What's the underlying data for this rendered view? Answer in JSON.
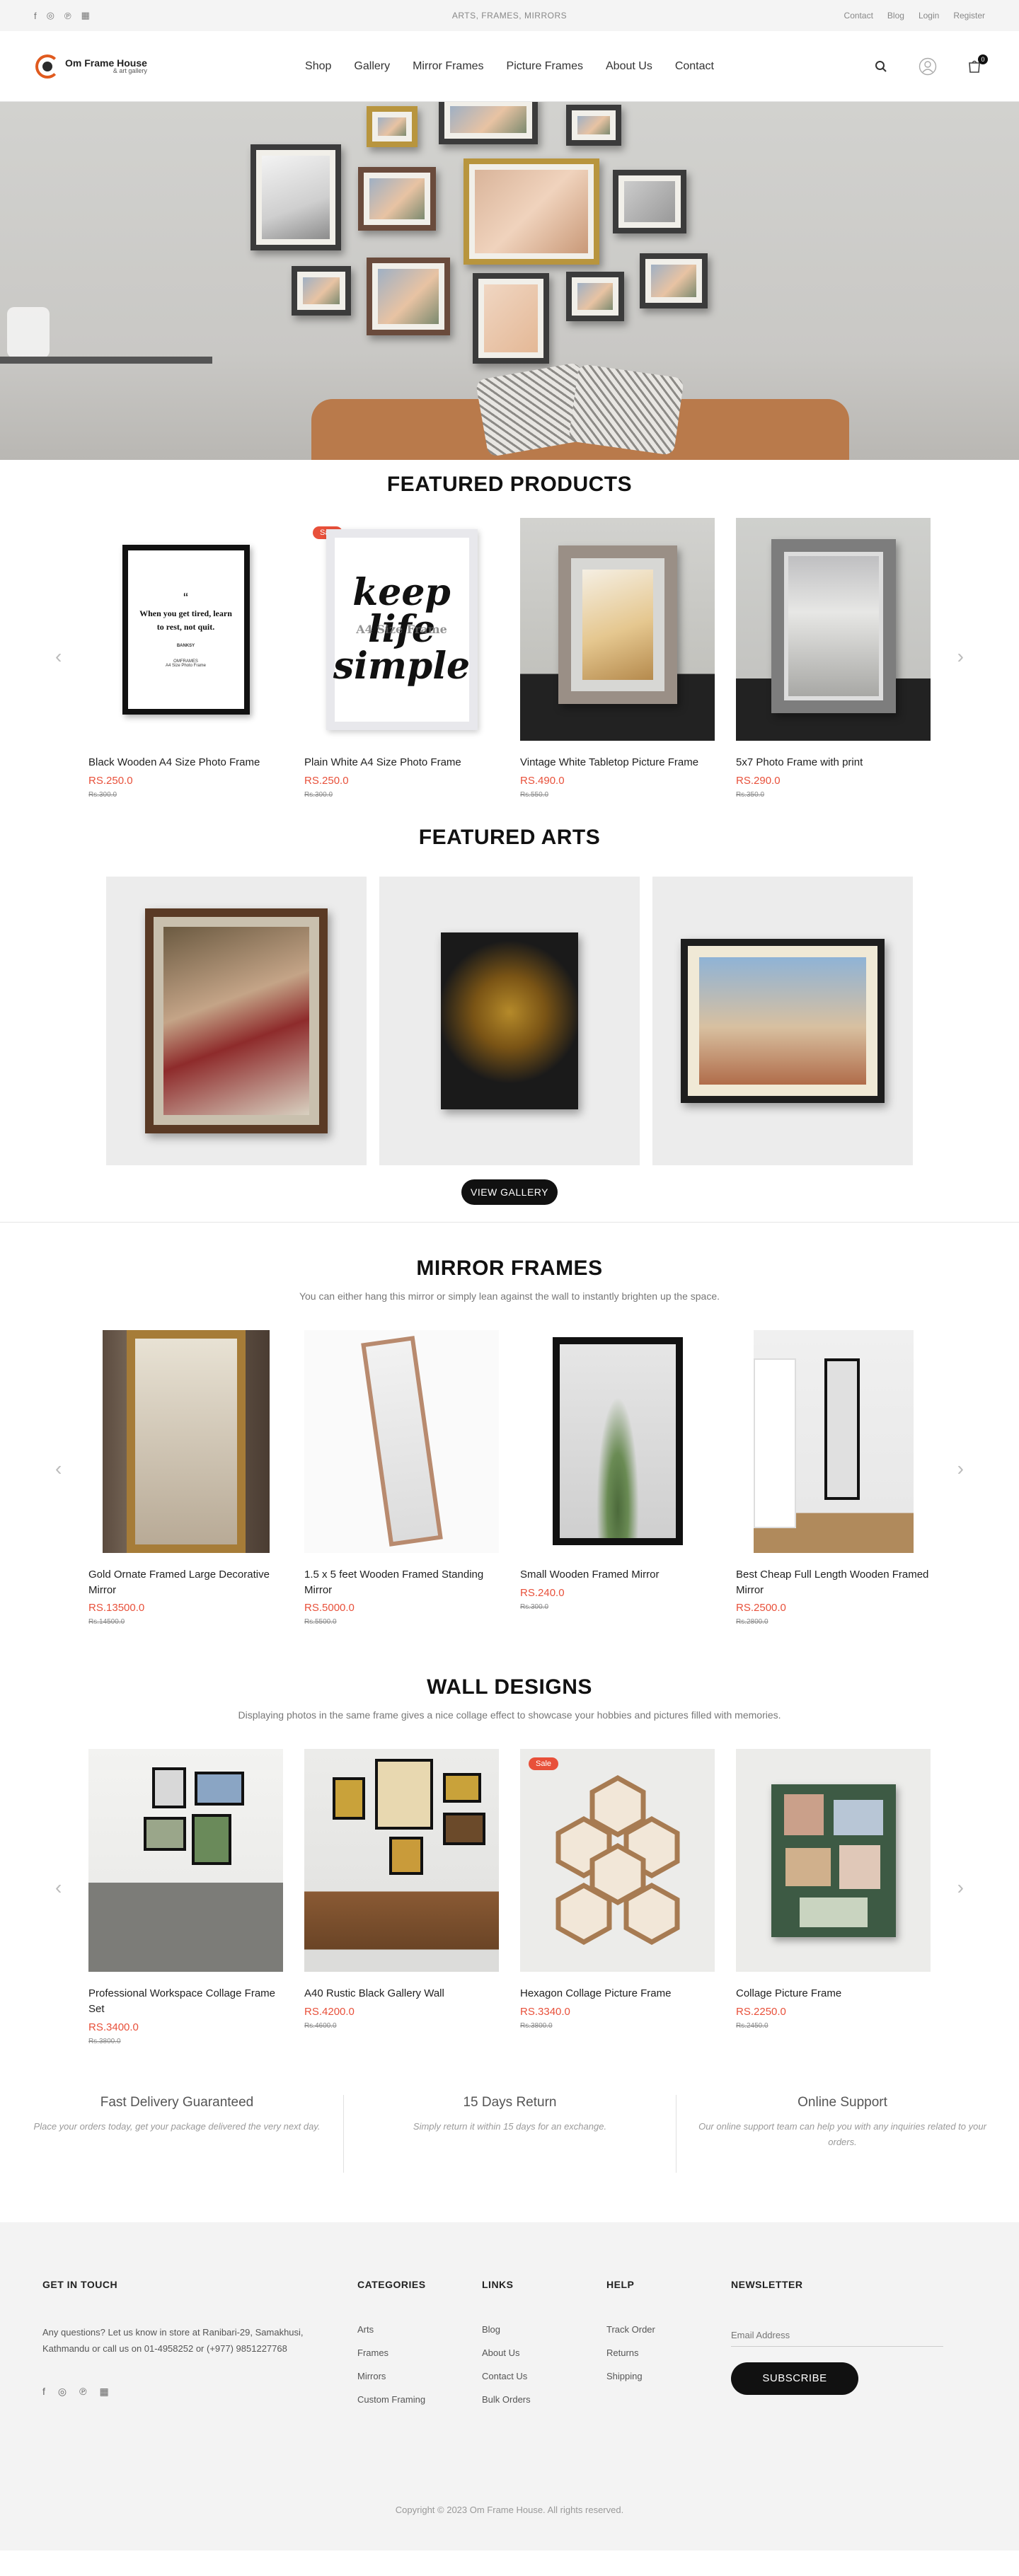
{
  "topbar": {
    "social": [
      {
        "icon": "facebook-icon",
        "glyph": "f"
      },
      {
        "icon": "instagram-icon",
        "glyph": "◎"
      },
      {
        "icon": "pinterest-icon",
        "glyph": "℗"
      },
      {
        "icon": "map-icon",
        "glyph": "▦"
      }
    ],
    "promo": "ARTS, FRAMES, MIRRORS",
    "links": [
      "Contact",
      "Blog",
      "Login",
      "Register"
    ]
  },
  "header": {
    "logo_name": "Om Frame House",
    "logo_sub": "& art gallery",
    "nav": [
      "Shop",
      "Gallery",
      "Mirror Frames",
      "Picture Frames",
      "About Us",
      "Contact"
    ],
    "cart_count": "0"
  },
  "featured_products": {
    "title": "FEATURED PRODUCTS",
    "items": [
      {
        "name": "Black Wooden A4 Size Photo Frame",
        "price": "RS.250.0",
        "old": "Rs.300.0",
        "badge": ""
      },
      {
        "name": "Plain White A4 Size Photo Frame",
        "price": "RS.250.0",
        "old": "Rs.300.0",
        "badge": "Sale"
      },
      {
        "name": "Vintage White Tabletop Picture Frame",
        "price": "RS.490.0",
        "old": "Rs.550.0",
        "badge": ""
      },
      {
        "name": "5x7 Photo Frame with print",
        "price": "RS.290.0",
        "old": "Rs.350.0",
        "badge": ""
      }
    ],
    "quote": "When you get tired, learn to rest, not quit.",
    "quote_author": "BANKSY",
    "quote_tag": "OMFRAMES",
    "quote_tag2": "A4 Size Photo Frame",
    "keep_words": [
      "keep",
      "life",
      "simple"
    ],
    "keep_overlay": "A4 Size Frame"
  },
  "featured_arts": {
    "title": "FEATURED ARTS",
    "button": "VIEW GALLERY"
  },
  "mirror_frames": {
    "title": "MIRROR FRAMES",
    "subtitle": "You can either hang this mirror or simply lean against the wall to instantly brighten up the space.",
    "items": [
      {
        "name": "Gold Ornate Framed Large Decorative Mirror",
        "price": "RS.13500.0",
        "old": "Rs.14500.0",
        "badge": ""
      },
      {
        "name": "1.5 x 5 feet Wooden Framed Standing Mirror",
        "price": "RS.5000.0",
        "old": "Rs.5500.0",
        "badge": ""
      },
      {
        "name": "Small Wooden Framed Mirror",
        "price": "RS.240.0",
        "old": "Rs.300.0",
        "badge": ""
      },
      {
        "name": "Best Cheap Full Length Wooden Framed Mirror",
        "price": "RS.2500.0",
        "old": "Rs.2800.0",
        "badge": ""
      }
    ]
  },
  "wall_designs": {
    "title": "WALL DESIGNS",
    "subtitle": "Displaying photos in the same frame gives a nice collage effect to showcase your hobbies and pictures filled with memories.",
    "items": [
      {
        "name": "Professional Workspace Collage Frame Set",
        "price": "RS.3400.0",
        "old": "Rs.3800.0",
        "badge": ""
      },
      {
        "name": "A40 Rustic Black Gallery Wall",
        "price": "RS.4200.0",
        "old": "Rs.4600.0",
        "badge": ""
      },
      {
        "name": "Hexagon Collage Picture Frame",
        "price": "RS.3340.0",
        "old": "Rs.3800.0",
        "badge": "Sale"
      },
      {
        "name": "Collage Picture Frame",
        "price": "RS.2250.0",
        "old": "Rs.2450.0",
        "badge": ""
      }
    ]
  },
  "features": [
    {
      "title": "Fast Delivery Guaranteed",
      "desc": "Place your orders today, get your package delivered the very next day."
    },
    {
      "title": "15 Days Return",
      "desc": "Simply return it within 15 days for an exchange."
    },
    {
      "title": "Online Support",
      "desc": "Our online support team can help you with any inquiries related to your orders."
    }
  ],
  "footer": {
    "git_title": "GET IN TOUCH",
    "git_text": "Any questions? Let us know in store at Ranibari-29, Samakhusi, Kathmandu or call us on 01-4958252 or (+977) 9851227768",
    "categories_title": "CATEGORIES",
    "categories": [
      "Arts",
      "Frames",
      "Mirrors",
      "Custom Framing"
    ],
    "links_title": "LINKS",
    "links": [
      "Blog",
      "About Us",
      "Contact Us",
      "Bulk Orders"
    ],
    "help_title": "HELP",
    "help": [
      "Track Order",
      "Returns",
      "Shipping"
    ],
    "news_title": "NEWSLETTER",
    "email_placeholder": "Email Address",
    "subscribe": "SUBSCRIBE",
    "copyright": "Copyright © 2023 Om Frame House. All rights reserved."
  },
  "colors": {
    "accent": "#e8503a",
    "dark": "#111111",
    "logo_orange": "#e05a1e"
  }
}
